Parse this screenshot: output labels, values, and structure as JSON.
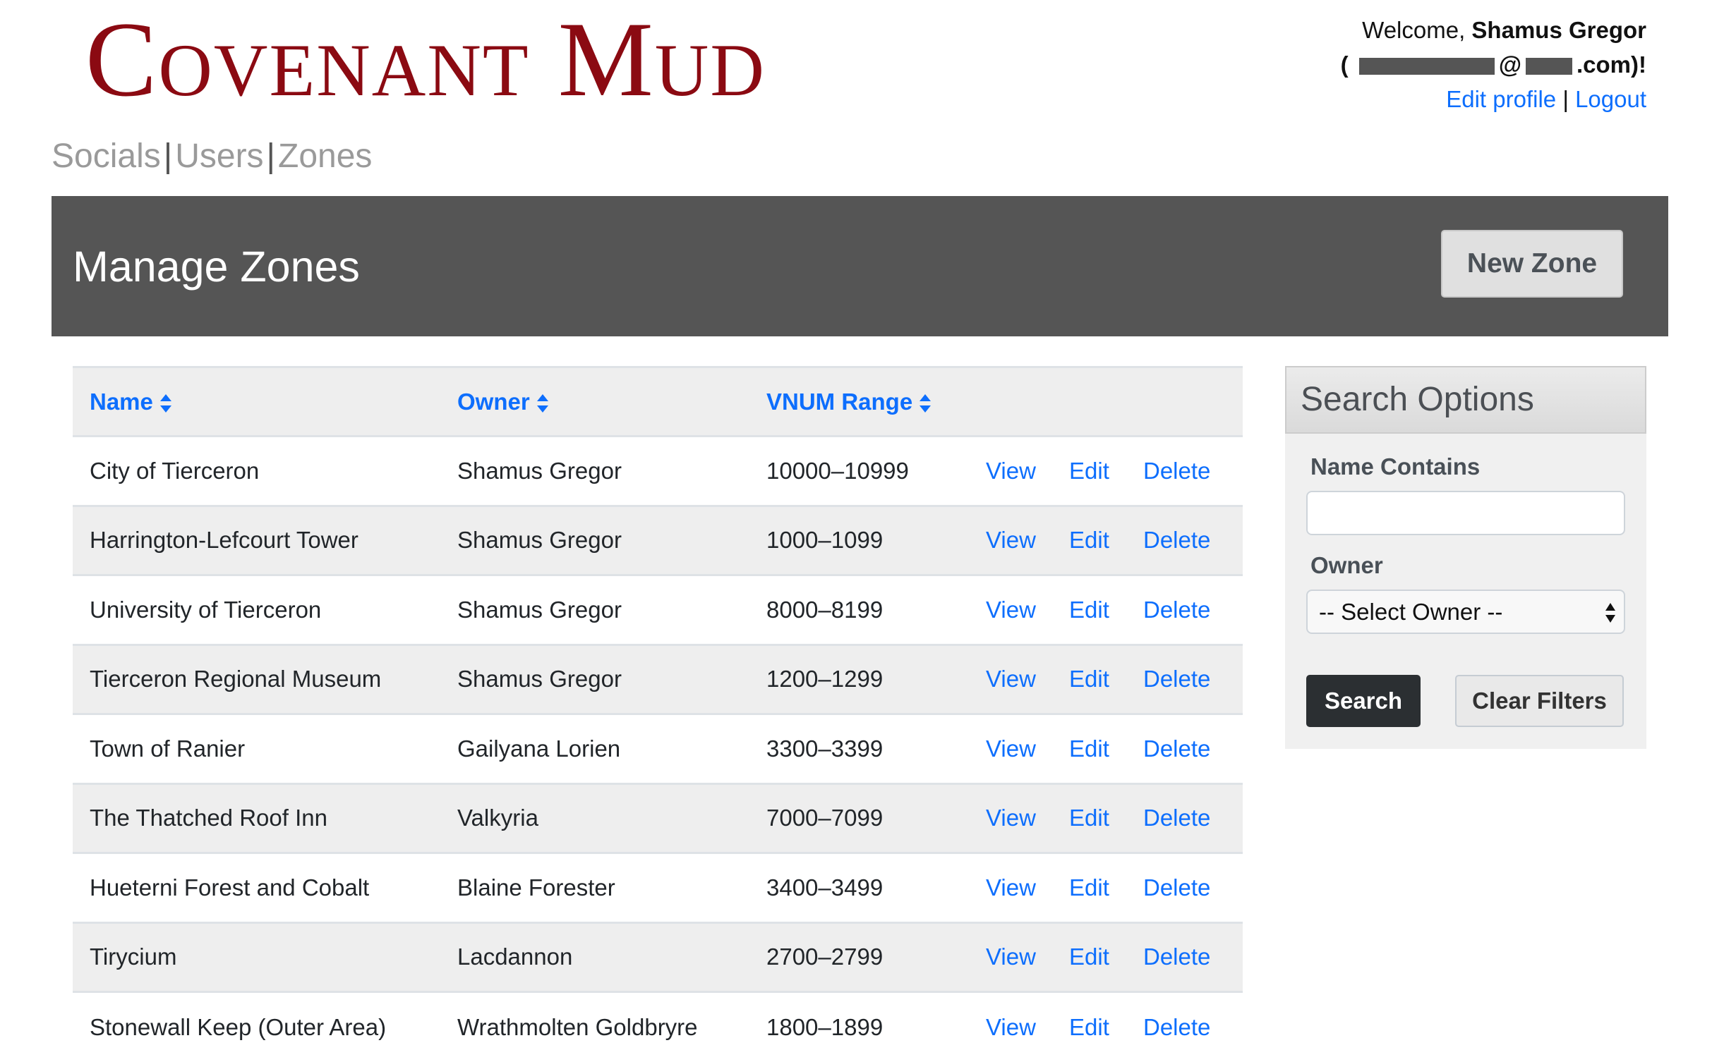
{
  "header": {
    "logo_first": "Covenant",
    "logo_second": "Mud",
    "welcome_prefix": "Welcome, ",
    "user_name": "Shamus Gregor",
    "email_open": "(",
    "email_at": "@",
    "email_suffix": ".com)!",
    "edit_profile": "Edit profile",
    "link_sep": "|",
    "logout": "Logout"
  },
  "nav": {
    "items": [
      "Socials",
      "Users",
      "Zones"
    ],
    "sep": "|"
  },
  "banner": {
    "title": "Manage Zones",
    "new_button": "New Zone"
  },
  "table": {
    "columns": [
      "Name",
      "Owner",
      "VNUM Range"
    ],
    "actions": {
      "view": "View",
      "edit": "Edit",
      "delete": "Delete"
    },
    "rows": [
      {
        "name": "City of Tierceron",
        "owner": "Shamus Gregor",
        "range": "10000–10999"
      },
      {
        "name": "Harrington-Lefcourt Tower",
        "owner": "Shamus Gregor",
        "range": "1000–1099"
      },
      {
        "name": "University of Tierceron",
        "owner": "Shamus Gregor",
        "range": "8000–8199"
      },
      {
        "name": "Tierceron Regional Museum",
        "owner": "Shamus Gregor",
        "range": "1200–1299"
      },
      {
        "name": "Town of Ranier",
        "owner": "Gailyana Lorien",
        "range": "3300–3399"
      },
      {
        "name": "The Thatched Roof Inn",
        "owner": "Valkyria",
        "range": "7000–7099"
      },
      {
        "name": "Hueterni Forest and Cobalt",
        "owner": "Blaine Forester",
        "range": "3400–3499"
      },
      {
        "name": "Tirycium",
        "owner": "Lacdannon",
        "range": "2700–2799"
      },
      {
        "name": "Stonewall Keep (Outer Area)",
        "owner": "Wrathmolten Goldbryre",
        "range": "1800–1899"
      }
    ]
  },
  "search": {
    "title": "Search Options",
    "name_label": "Name Contains",
    "name_value": "",
    "owner_label": "Owner",
    "owner_selected": "-- Select Owner --",
    "search_button": "Search",
    "clear_button": "Clear Filters"
  },
  "colors": {
    "brand": "#8b0a12",
    "link": "#0d6efd",
    "banner": "#555555",
    "search_button": "#2b2f32"
  }
}
